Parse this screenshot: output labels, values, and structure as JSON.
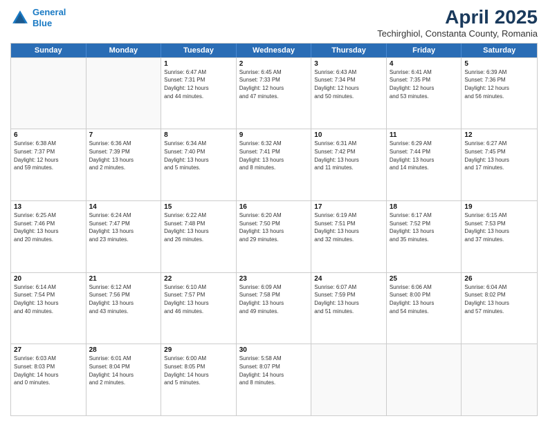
{
  "header": {
    "logo_line1": "General",
    "logo_line2": "Blue",
    "main_title": "April 2025",
    "subtitle": "Techirghiol, Constanta County, Romania"
  },
  "days_of_week": [
    "Sunday",
    "Monday",
    "Tuesday",
    "Wednesday",
    "Thursday",
    "Friday",
    "Saturday"
  ],
  "weeks": [
    [
      {
        "num": "",
        "info": "",
        "empty": true
      },
      {
        "num": "",
        "info": "",
        "empty": true
      },
      {
        "num": "1",
        "info": "Sunrise: 6:47 AM\nSunset: 7:31 PM\nDaylight: 12 hours\nand 44 minutes.",
        "empty": false
      },
      {
        "num": "2",
        "info": "Sunrise: 6:45 AM\nSunset: 7:33 PM\nDaylight: 12 hours\nand 47 minutes.",
        "empty": false
      },
      {
        "num": "3",
        "info": "Sunrise: 6:43 AM\nSunset: 7:34 PM\nDaylight: 12 hours\nand 50 minutes.",
        "empty": false
      },
      {
        "num": "4",
        "info": "Sunrise: 6:41 AM\nSunset: 7:35 PM\nDaylight: 12 hours\nand 53 minutes.",
        "empty": false
      },
      {
        "num": "5",
        "info": "Sunrise: 6:39 AM\nSunset: 7:36 PM\nDaylight: 12 hours\nand 56 minutes.",
        "empty": false
      }
    ],
    [
      {
        "num": "6",
        "info": "Sunrise: 6:38 AM\nSunset: 7:37 PM\nDaylight: 12 hours\nand 59 minutes.",
        "empty": false
      },
      {
        "num": "7",
        "info": "Sunrise: 6:36 AM\nSunset: 7:39 PM\nDaylight: 13 hours\nand 2 minutes.",
        "empty": false
      },
      {
        "num": "8",
        "info": "Sunrise: 6:34 AM\nSunset: 7:40 PM\nDaylight: 13 hours\nand 5 minutes.",
        "empty": false
      },
      {
        "num": "9",
        "info": "Sunrise: 6:32 AM\nSunset: 7:41 PM\nDaylight: 13 hours\nand 8 minutes.",
        "empty": false
      },
      {
        "num": "10",
        "info": "Sunrise: 6:31 AM\nSunset: 7:42 PM\nDaylight: 13 hours\nand 11 minutes.",
        "empty": false
      },
      {
        "num": "11",
        "info": "Sunrise: 6:29 AM\nSunset: 7:44 PM\nDaylight: 13 hours\nand 14 minutes.",
        "empty": false
      },
      {
        "num": "12",
        "info": "Sunrise: 6:27 AM\nSunset: 7:45 PM\nDaylight: 13 hours\nand 17 minutes.",
        "empty": false
      }
    ],
    [
      {
        "num": "13",
        "info": "Sunrise: 6:25 AM\nSunset: 7:46 PM\nDaylight: 13 hours\nand 20 minutes.",
        "empty": false
      },
      {
        "num": "14",
        "info": "Sunrise: 6:24 AM\nSunset: 7:47 PM\nDaylight: 13 hours\nand 23 minutes.",
        "empty": false
      },
      {
        "num": "15",
        "info": "Sunrise: 6:22 AM\nSunset: 7:48 PM\nDaylight: 13 hours\nand 26 minutes.",
        "empty": false
      },
      {
        "num": "16",
        "info": "Sunrise: 6:20 AM\nSunset: 7:50 PM\nDaylight: 13 hours\nand 29 minutes.",
        "empty": false
      },
      {
        "num": "17",
        "info": "Sunrise: 6:19 AM\nSunset: 7:51 PM\nDaylight: 13 hours\nand 32 minutes.",
        "empty": false
      },
      {
        "num": "18",
        "info": "Sunrise: 6:17 AM\nSunset: 7:52 PM\nDaylight: 13 hours\nand 35 minutes.",
        "empty": false
      },
      {
        "num": "19",
        "info": "Sunrise: 6:15 AM\nSunset: 7:53 PM\nDaylight: 13 hours\nand 37 minutes.",
        "empty": false
      }
    ],
    [
      {
        "num": "20",
        "info": "Sunrise: 6:14 AM\nSunset: 7:54 PM\nDaylight: 13 hours\nand 40 minutes.",
        "empty": false
      },
      {
        "num": "21",
        "info": "Sunrise: 6:12 AM\nSunset: 7:56 PM\nDaylight: 13 hours\nand 43 minutes.",
        "empty": false
      },
      {
        "num": "22",
        "info": "Sunrise: 6:10 AM\nSunset: 7:57 PM\nDaylight: 13 hours\nand 46 minutes.",
        "empty": false
      },
      {
        "num": "23",
        "info": "Sunrise: 6:09 AM\nSunset: 7:58 PM\nDaylight: 13 hours\nand 49 minutes.",
        "empty": false
      },
      {
        "num": "24",
        "info": "Sunrise: 6:07 AM\nSunset: 7:59 PM\nDaylight: 13 hours\nand 51 minutes.",
        "empty": false
      },
      {
        "num": "25",
        "info": "Sunrise: 6:06 AM\nSunset: 8:00 PM\nDaylight: 13 hours\nand 54 minutes.",
        "empty": false
      },
      {
        "num": "26",
        "info": "Sunrise: 6:04 AM\nSunset: 8:02 PM\nDaylight: 13 hours\nand 57 minutes.",
        "empty": false
      }
    ],
    [
      {
        "num": "27",
        "info": "Sunrise: 6:03 AM\nSunset: 8:03 PM\nDaylight: 14 hours\nand 0 minutes.",
        "empty": false
      },
      {
        "num": "28",
        "info": "Sunrise: 6:01 AM\nSunset: 8:04 PM\nDaylight: 14 hours\nand 2 minutes.",
        "empty": false
      },
      {
        "num": "29",
        "info": "Sunrise: 6:00 AM\nSunset: 8:05 PM\nDaylight: 14 hours\nand 5 minutes.",
        "empty": false
      },
      {
        "num": "30",
        "info": "Sunrise: 5:58 AM\nSunset: 8:07 PM\nDaylight: 14 hours\nand 8 minutes.",
        "empty": false
      },
      {
        "num": "",
        "info": "",
        "empty": true
      },
      {
        "num": "",
        "info": "",
        "empty": true
      },
      {
        "num": "",
        "info": "",
        "empty": true
      }
    ]
  ]
}
